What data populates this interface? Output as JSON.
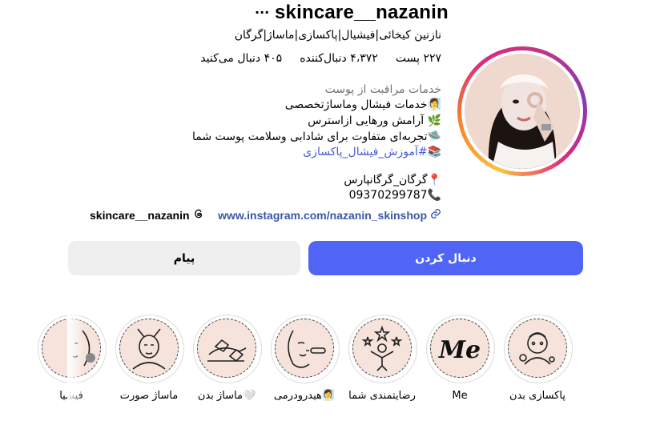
{
  "profile": {
    "username": "skincare__nazanin",
    "more": "···",
    "full_name": "نازنین کیخائی|فیشیال|پاکسازی|ماساژ|گرگان",
    "stats": {
      "posts": "۲۲۷ پست",
      "followers": "۴،۳۷۲ دنبال‌کننده",
      "following": "۴۰۵ دنبال می‌کنید"
    },
    "category": "خدمات مراقبت از پوست",
    "bio": [
      "🧖‍♀️خدمات فیشال وماساژتخصصی",
      "🌿 آرامش ورهایی ازاسترس",
      "🛸تجربه‌ای متفاوت برای شادابی وسلامت پوست شما",
      "📚#آموزش_فیشال_پاکسازی"
    ],
    "location": "📍گرگان_گرگانپارس",
    "phone": "09370299787📞",
    "link": "www.instagram.com/nazanin_skinshop",
    "threads": "skincare__nazanin"
  },
  "actions": {
    "follow": "دنبال کردن",
    "message": "پیام"
  },
  "highlights": [
    {
      "label": "پاکسازی بدن",
      "icon": "facial-mask-icon"
    },
    {
      "label": "Me",
      "icon": "me-text-icon"
    },
    {
      "label": "رضایتمندی شما",
      "icon": "stars-person-icon"
    },
    {
      "label": "هیدرودرمی🧖‍♀️",
      "icon": "face-tool-icon"
    },
    {
      "label": "ماساژ بدن🤍",
      "icon": "massage-hands-icon"
    },
    {
      "label": "ماساژ صورت",
      "icon": "face-massage-icon"
    },
    {
      "label": "فیشیا",
      "icon": "facial-icon"
    }
  ],
  "colors": {
    "follow": "#5065f6",
    "message": "#efefef",
    "link": "#3a57a8",
    "hashtag": "#4a5ad8",
    "category": "#737373"
  }
}
